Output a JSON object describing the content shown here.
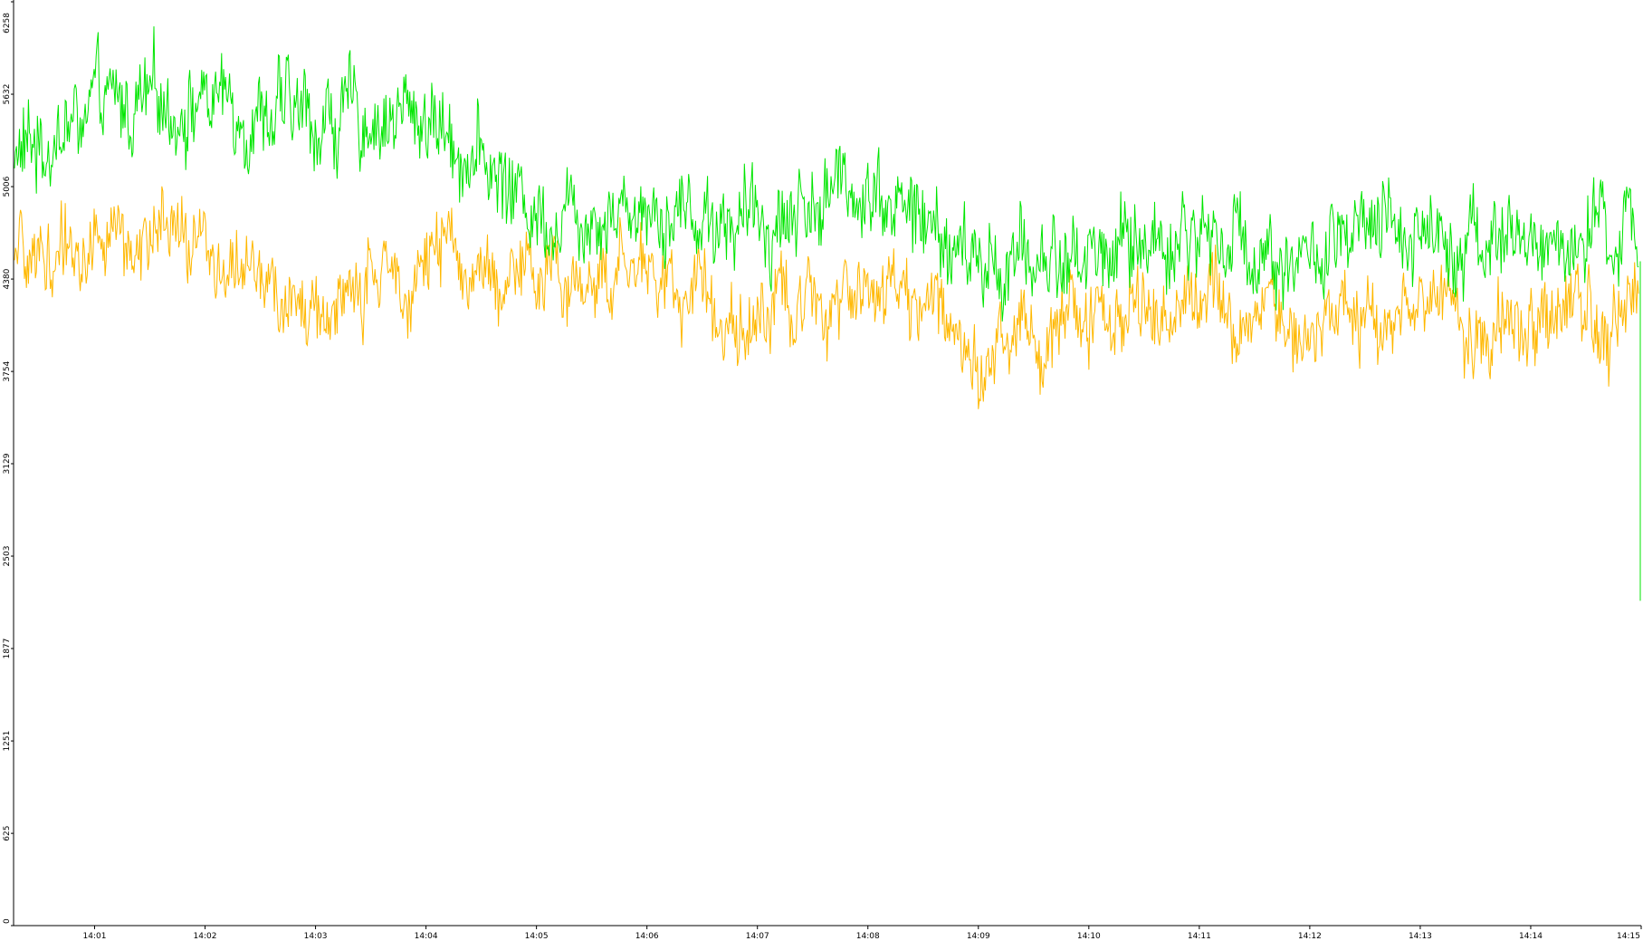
{
  "chart_data": {
    "type": "line",
    "title": "",
    "xlabel": "",
    "ylabel": "",
    "ylim": [
      0,
      6258
    ],
    "y_ticks": [
      "0",
      "625",
      "1251",
      "1877",
      "2503",
      "3129",
      "3754",
      "4380",
      "5006",
      "5632",
      "6258"
    ],
    "x_ticks": [
      "14:01",
      "14:02",
      "14:03",
      "14:04",
      "14:05",
      "14:06",
      "14:07",
      "14:08",
      "14:09",
      "14:10",
      "14:11",
      "14:12",
      "14:13",
      "14:14",
      "14:15"
    ],
    "x_range": [
      "14:00:16",
      "14:15:00"
    ],
    "grid": false,
    "legend": "none",
    "series": [
      {
        "color": "#00e600",
        "x": [
          "14:00:16",
          "14:01",
          "14:02",
          "14:03",
          "14:04",
          "14:05",
          "14:06",
          "14:07",
          "14:08",
          "14:09",
          "14:10",
          "14:11",
          "14:12",
          "14:13",
          "14:14",
          "14:15"
        ],
        "values": [
          5200,
          5500,
          5600,
          5450,
          5500,
          4850,
          4900,
          4750,
          5050,
          4450,
          4550,
          4700,
          4500,
          4750,
          4600,
          4650
        ],
        "spread": 420
      },
      {
        "color": "#ffb800",
        "x": [
          "14:00:16",
          "14:01",
          "14:02",
          "14:03",
          "14:04",
          "14:05",
          "14:06",
          "14:07",
          "14:08",
          "14:09",
          "14:10",
          "14:11",
          "14:12",
          "14:13",
          "14:14",
          "14:15"
        ],
        "values": [
          4450,
          4650,
          4600,
          4100,
          4550,
          4350,
          4450,
          4100,
          4400,
          3950,
          4100,
          4300,
          4050,
          4200,
          4000,
          4200
        ],
        "spread": 380
      }
    ]
  }
}
